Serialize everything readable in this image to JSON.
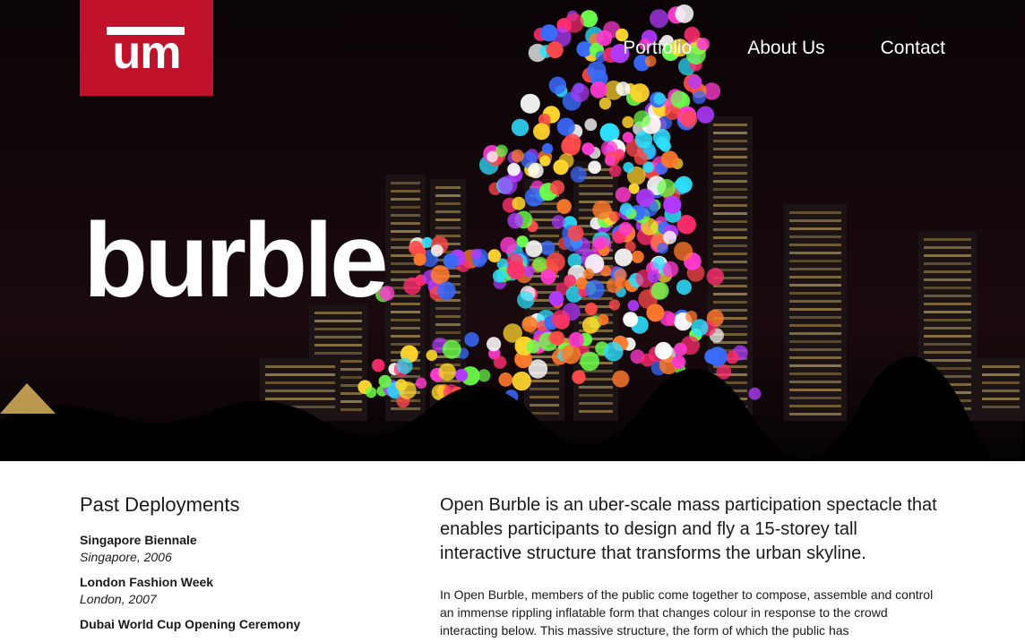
{
  "brand": {
    "logo_text": "um",
    "color": "#c0122a"
  },
  "nav": {
    "items": [
      {
        "label": "Portfolio"
      },
      {
        "label": "About Us"
      },
      {
        "label": "Contact"
      }
    ]
  },
  "hero": {
    "title": "burble"
  },
  "deployments": {
    "heading": "Past Deployments",
    "items": [
      {
        "name": "Singapore Biennale",
        "place": "Singapore, 2006"
      },
      {
        "name": "London Fashion Week",
        "place": "London, 2007"
      },
      {
        "name": "Dubai World Cup Opening Ceremony",
        "place": ""
      }
    ]
  },
  "description": {
    "lead": "Open Burble is an uber-scale mass participation spectacle that enables participants to design and fly a 15-storey tall interactive structure that transforms the urban skyline.",
    "body": "In Open Burble, members of the public come together to compose, assemble and control an immense rippling inflatable form that changes colour in response to the crowd interacting below. This massive structure, the form of which the public has"
  }
}
